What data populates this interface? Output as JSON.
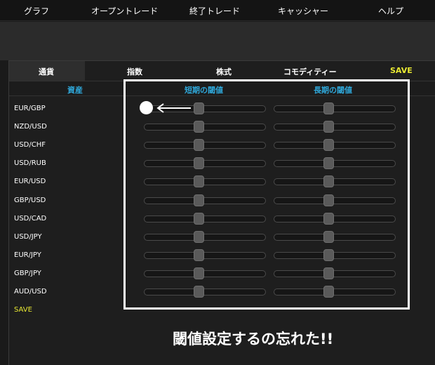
{
  "menu": {
    "items": [
      "グラフ",
      "オープントレード",
      "終了トレード",
      "キャッシャー",
      "ヘルプ"
    ]
  },
  "tabs": {
    "items": [
      "通貨",
      "指数",
      "株式",
      "コモディティー"
    ],
    "active": "通貨",
    "save_label": "SAVE"
  },
  "columns": {
    "asset": "資産",
    "short_threshold": "短期の閾値",
    "long_threshold": "長期の閾値"
  },
  "assets": [
    "EUR/GBP",
    "NZD/USD",
    "USD/CHF",
    "USD/RUB",
    "EUR/USD",
    "GBP/USD",
    "USD/CAD",
    "USD/JPY",
    "EUR/JPY",
    "GBP/JPY",
    "AUD/USD"
  ],
  "slider_levels": {
    "short_threshold": 0.45,
    "long_threshold": 0.45
  },
  "save_link_label": "SAVE",
  "annotation": {
    "caption": "閾値設定するの忘れた!!"
  },
  "colors": {
    "accent_blue": "#2fa7d9",
    "save_yellow": "#e8e832",
    "annotation": "#ffffff"
  }
}
